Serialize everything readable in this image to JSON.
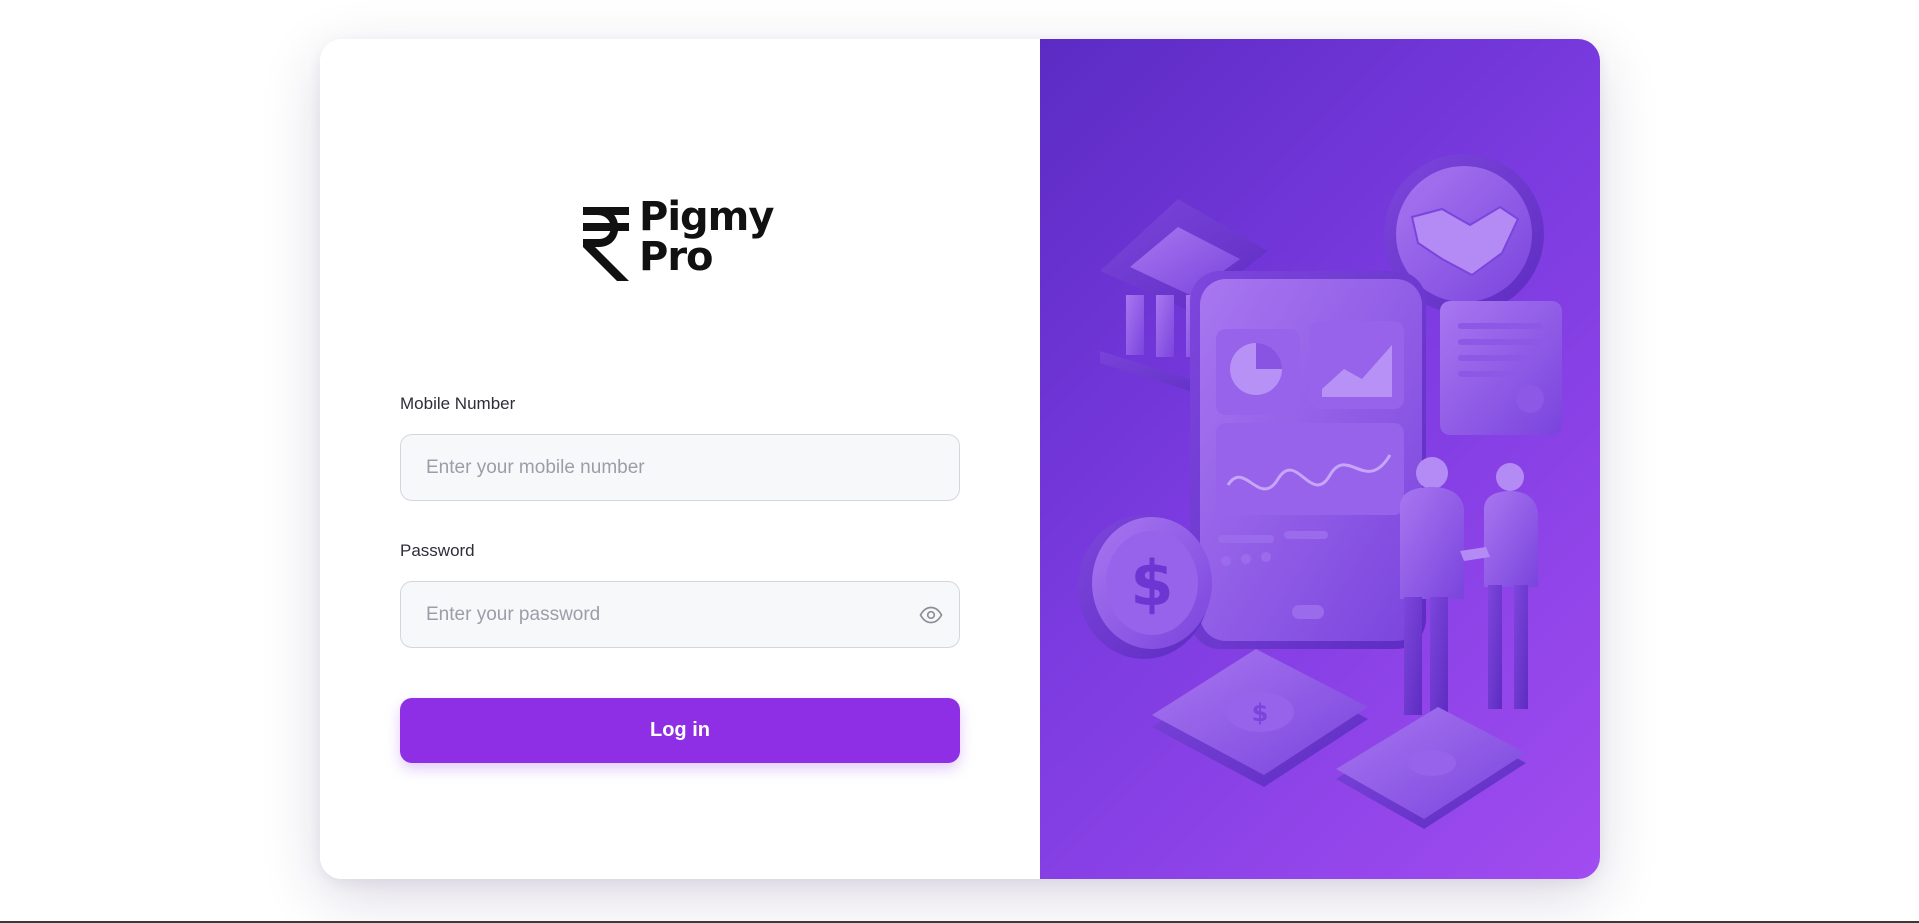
{
  "brand": {
    "name_line1": "Pigmy",
    "name_line2": "Pro",
    "logo_symbol": "₹"
  },
  "form": {
    "mobile_label": "Mobile Number",
    "mobile_placeholder": "Enter your mobile number",
    "mobile_value": "",
    "password_label": "Password",
    "password_placeholder": "Enter your password",
    "password_value": "",
    "password_toggle_icon": "eye-icon",
    "submit_label": "Log in"
  },
  "colors": {
    "accent": "#8e2fe6",
    "panel_gradient_start": "#5b2bc4",
    "panel_gradient_end": "#a14cf0"
  },
  "illustration": {
    "icons": [
      "bank-icon",
      "handshake-icon",
      "tablet-dashboard-icon",
      "certificate-icon",
      "dollar-coin-icon",
      "cash-stack-icon",
      "business-people-icon"
    ]
  }
}
